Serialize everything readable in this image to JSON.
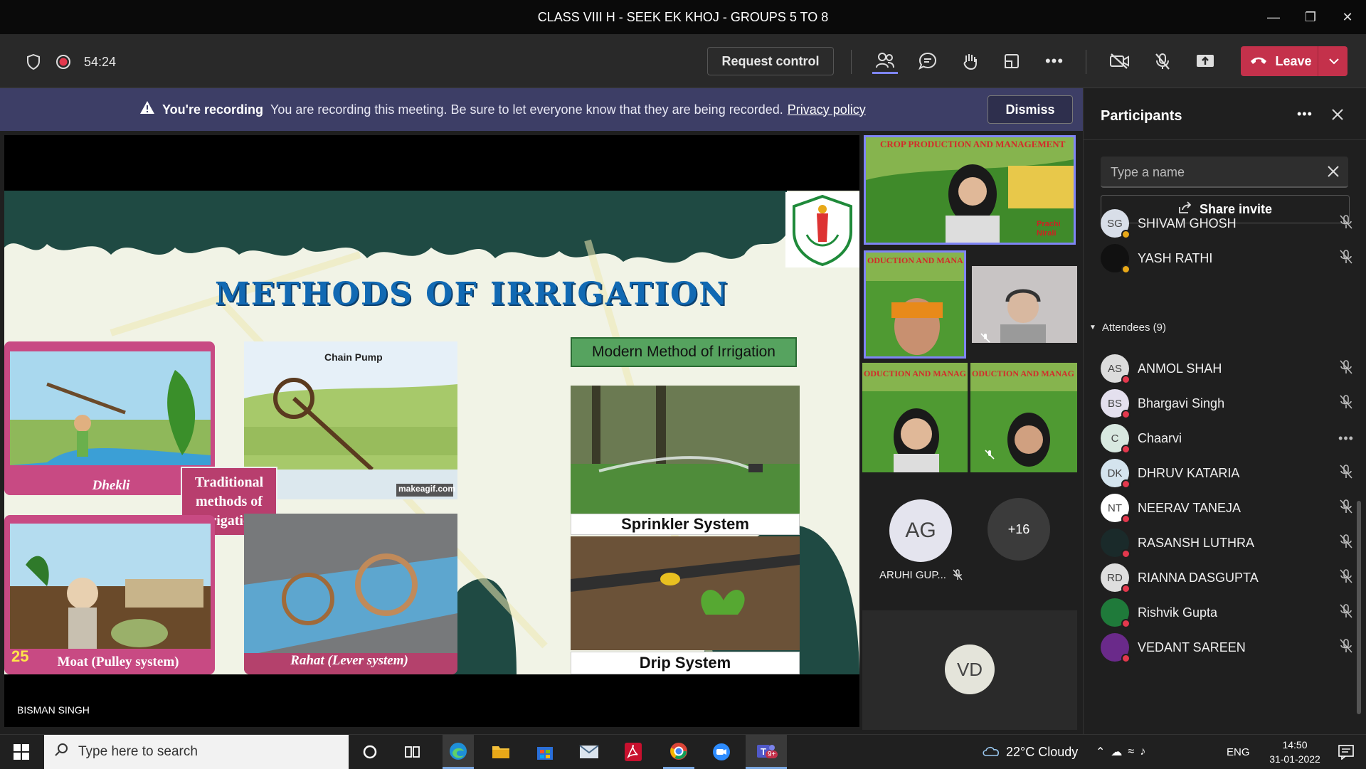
{
  "window": {
    "title": "CLASS VIII H - SEEK EK KHOJ - GROUPS 5 TO 8"
  },
  "toolbar": {
    "timer": "54:24",
    "request_control": "Request control",
    "leave": "Leave"
  },
  "banner": {
    "bold": "You're recording",
    "message": "You are recording this meeting. Be sure to let everyone know that they are being recorded.",
    "link": "Privacy policy",
    "dismiss": "Dismiss"
  },
  "slide": {
    "title": "METHODS OF IRRIGATION",
    "modern_label": "Modern Method of Irrigation",
    "chain_pump": "Chain Pump",
    "makeagif": "makeagif.com",
    "dhekli": "Dhekli",
    "traditional": "Traditional methods of irrigation",
    "moat": "Moat (Pulley system)",
    "rahat": "Rahat (Lever system)",
    "sprinkler": "Sprinkler System",
    "drip": "Drip System",
    "page_num": "25"
  },
  "stage": {
    "presenter_name": "BISMAN SINGH"
  },
  "videos": {
    "main_banner": "CROP PRODUCTION AND MANAGEMENT",
    "main_names": "Prachi Nirali",
    "tile_banner": "ODUCTION AND MANA",
    "tile_banner2": "ODUCTION AND MANAG",
    "ag_initials": "AG",
    "ag_name": "ARUHI GUP...",
    "more_count": "+16",
    "vd_initials": "VD"
  },
  "panel": {
    "title": "Participants",
    "search_placeholder": "Type a name",
    "share_invite": "Share invite",
    "attendees_header": "Attendees (9)",
    "presenters": [
      {
        "initials": "SG",
        "name": "SHIVAM GHOSH"
      },
      {
        "initials": "",
        "name": "YASH RATHI"
      }
    ],
    "attendees": [
      {
        "initials": "AS",
        "name": "ANMOL SHAH"
      },
      {
        "initials": "BS",
        "name": "Bhargavi Singh"
      },
      {
        "initials": "C",
        "name": "Chaarvi"
      },
      {
        "initials": "DK",
        "name": "DHRUV KATARIA"
      },
      {
        "initials": "NT",
        "name": "NEERAV TANEJA"
      },
      {
        "initials": "",
        "name": "RASANSH LUTHRA"
      },
      {
        "initials": "RD",
        "name": "RIANNA DASGUPTA"
      },
      {
        "initials": "",
        "name": "Rishvik Gupta"
      },
      {
        "initials": "",
        "name": "VEDANT SAREEN"
      }
    ]
  },
  "taskbar": {
    "search_placeholder": "Type here to search",
    "weather": "22°C  Cloudy",
    "lang": "ENG",
    "time": "14:50",
    "date": "31-01-2022",
    "teams_badge": "9+"
  }
}
